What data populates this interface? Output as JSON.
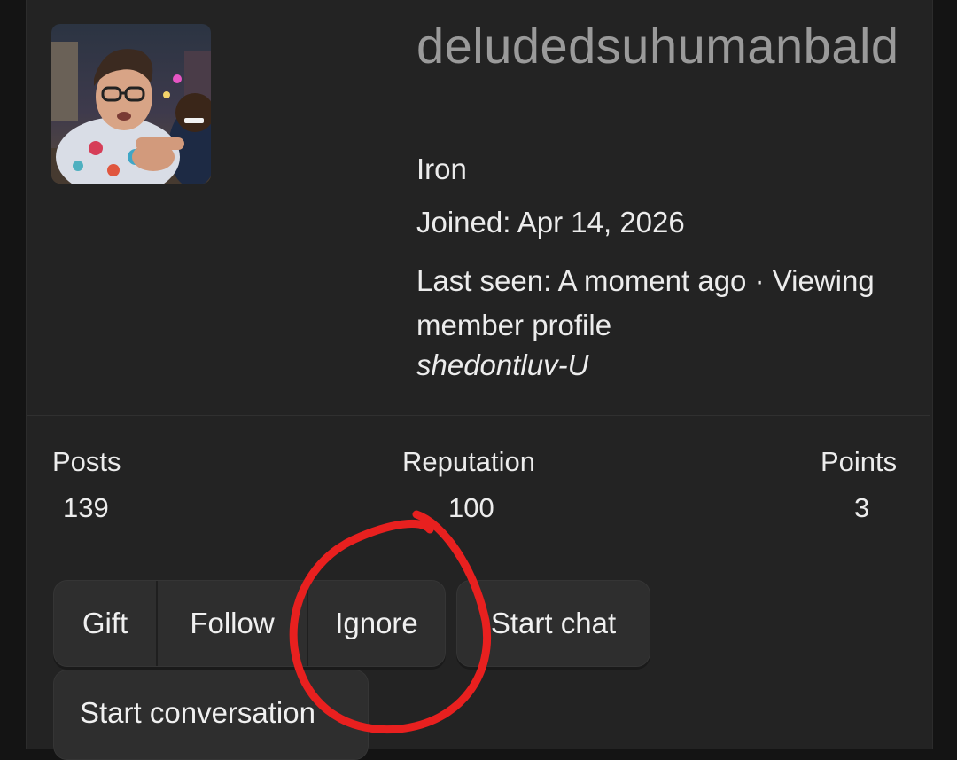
{
  "profile": {
    "username": "deludedsuhumanbald",
    "rank": "Iron",
    "joined": "Joined: Apr 14, 2026",
    "last_seen": "Last seen: A moment ago · Viewing member profile",
    "activity_target": "shedontluv-U"
  },
  "stats": {
    "posts_label": "Posts",
    "posts_value": "139",
    "reputation_label": "Reputation",
    "reputation_value": "100",
    "points_label": "Points",
    "points_value": "3"
  },
  "actions": {
    "gift": "Gift",
    "follow": "Follow",
    "ignore": "Ignore",
    "start_chat": "Start chat",
    "start_conversation": "Start conversation"
  },
  "colors": {
    "background": "#141414",
    "card": "#232323",
    "button": "#2e2e2e",
    "username": "#9a9a9a",
    "text": "#ececec",
    "annotation": "#e8201f"
  }
}
